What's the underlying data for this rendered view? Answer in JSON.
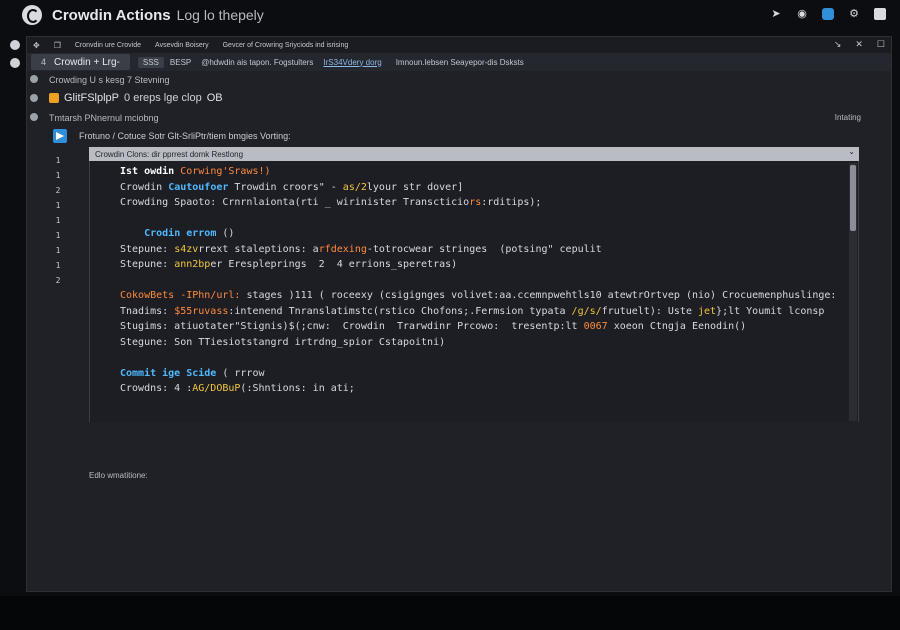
{
  "app": {
    "title": "Crowdin Actions",
    "subtitle": "Log lo thepely"
  },
  "menubar": {
    "items": [
      "Cronvdin ure Crovide",
      "Avsevdin Boisery",
      "Gevcer of Crowring Sriyciods ind isrising"
    ],
    "right_icons": [
      "↘",
      "✕",
      "☐"
    ]
  },
  "tabbar": {
    "active_tab_number": "4",
    "active_tab_label": "Crowdin + Lrg-",
    "chip_label": "SSS",
    "item_1": "BESP",
    "item_2": "@hdwdin ais tapon. Fogstulters",
    "link": "IrS34Vdery dorg",
    "item_3": "Imnoun.lebsen Seayepor-dis Dsksts"
  },
  "crumb": "Crowding U s kesg 7 Stevning",
  "file": {
    "name": "GlitFSlplpP",
    "rest": "0 еreps lge clop",
    "suffix": "OB"
  },
  "status_line": "Tmtarsh PNnernul mciobng",
  "status_right": "Intating",
  "description": "Frotuno / Cotuce Sotr Glt-SrliPtr/tiem bmgies Vorting:",
  "line_numbers": [
    "1",
    "1",
    "2",
    "1",
    "1",
    "1",
    "1",
    "1",
    "2"
  ],
  "editor": {
    "header": "Crowdin Clons: dir pprrest domk Restlong"
  },
  "code": {
    "l1_kw": "Ist owdin",
    "l1_or": "Corwing'Sraws!)",
    "l2_a": "Crowdin",
    "l2_bl": "Cautoufoer",
    "l2_b": " Trowdin croors\" - ",
    "l2_ye": "as/2",
    "l2_c": "lyour str dover]",
    "l3": "Crowding Spaoto: Crnrnlaionta(rti _ wirinister Transcticio",
    "l3_or": "rs",
    "l3_end": ":rditips);",
    "l5_bl": "Crodin errom",
    "l5_end": " ()",
    "l6_a": "Stepune: ",
    "l6_ye": "s4zv",
    "l6_b": "rrext staleptions: a",
    "l6_or": "rfdexing",
    "l6_c": "-totrocwear stringes  (potsing\" cepulit",
    "l7_a": "Stepune: ",
    "l7_ye": "ann2bp",
    "l7_b": "er Erespleprings  2  4 errions_speretras)",
    "l9_or": "CokowBets -IPhn/url:",
    "l9_b": " stages )111 ( roceexy (csigignges volivet:aa.ccemnpwehtls10 atewtrOrtvep (nio) Crocuemenphuslinge:",
    "l10_a": "Tnadims: ",
    "l10_or": "$55ruvass",
    "l10_b": ":intenend Tnranslatimstc(rstico Chofons;.Fermsion typata ",
    "l10_ye": "/g/s/",
    "l10_c": "frutuelt): Uste ",
    "l10_ye2": "jet",
    "l10_d": "};lt Youmit lconsp",
    "l11": "Stugims: atiuotater\"Stignis)$(;cnw:  Crowdin  Trarwdinr Prcowo:  tresentp:lt ",
    "l11_or": "0067",
    "l11_end": " xoeon Ctngja Eenodin()",
    "l12": "Stegune: Son TTiesiotstangrd irtrdng_spior Cstapoitni)",
    "l14_bl": "Commit ige Scide",
    "l14_end": " ( rrrow",
    "l15_a": "Crowdns: 4 :",
    "l15_ye": "AG/DOBuP",
    "l15_b": "(:Shntions: in ati;"
  },
  "footer_label": "Edlo wmatitione:"
}
